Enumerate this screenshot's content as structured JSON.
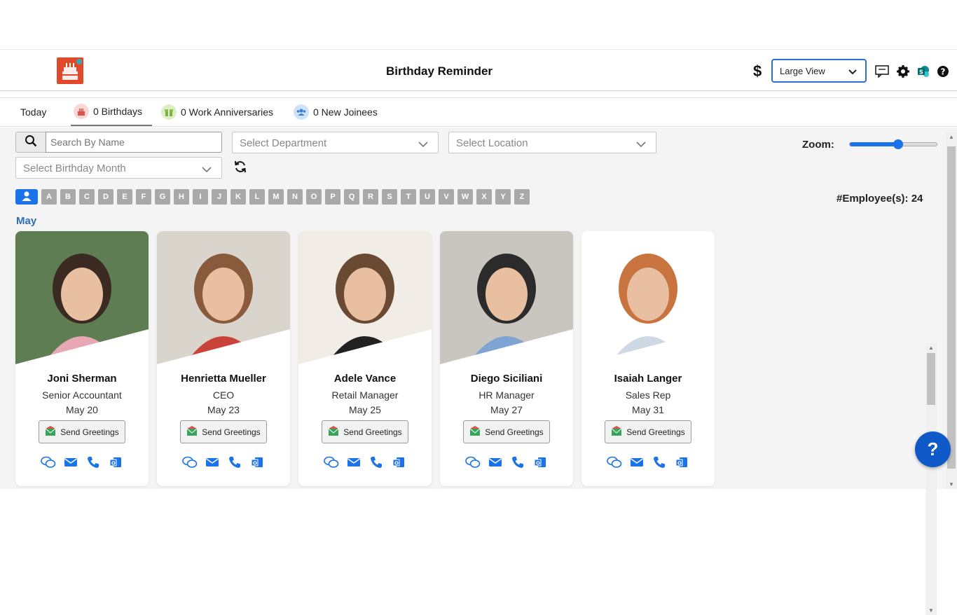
{
  "header": {
    "title": "Birthday Reminder",
    "currency_symbol": "$",
    "view_select": "Large View",
    "icons": [
      "feedback-icon",
      "settings-icon",
      "sharepoint-icon",
      "help-icon"
    ]
  },
  "tabs": [
    {
      "label": "Today"
    },
    {
      "label": "0 Birthdays"
    },
    {
      "label": "0 Work Anniversaries"
    },
    {
      "label": "0 New Joinees"
    }
  ],
  "filters": {
    "search_placeholder": "Search By Name",
    "department": "Select Department",
    "location": "Select Location",
    "birth_month": "Select Birthday Month",
    "zoom_label": "Zoom:",
    "zoom_level": 0.55
  },
  "alphabet": [
    "A",
    "B",
    "C",
    "D",
    "E",
    "F",
    "G",
    "H",
    "I",
    "J",
    "K",
    "L",
    "M",
    "N",
    "O",
    "P",
    "Q",
    "R",
    "S",
    "T",
    "U",
    "V",
    "W",
    "X",
    "Y",
    "Z"
  ],
  "employee_count": "#Employee(s): 24",
  "month_heading": "May",
  "greet_label": "Send Greetings",
  "employees": [
    {
      "name": "Joni Sherman",
      "title": "Senior Accountant",
      "date": "May 20"
    },
    {
      "name": "Henrietta Mueller",
      "title": "CEO",
      "date": "May 23"
    },
    {
      "name": "Adele Vance",
      "title": "Retail Manager",
      "date": "May 25"
    },
    {
      "name": "Diego Siciliani",
      "title": "HR Manager",
      "date": "May 27"
    },
    {
      "name": "Isaiah Langer",
      "title": "Sales Rep",
      "date": "May 31"
    }
  ],
  "fab_label": "?",
  "colors": {
    "accent": "#1a73e8",
    "month": "#2b6fb3",
    "logo": "#e0492b",
    "fab": "#0f5ac8"
  }
}
